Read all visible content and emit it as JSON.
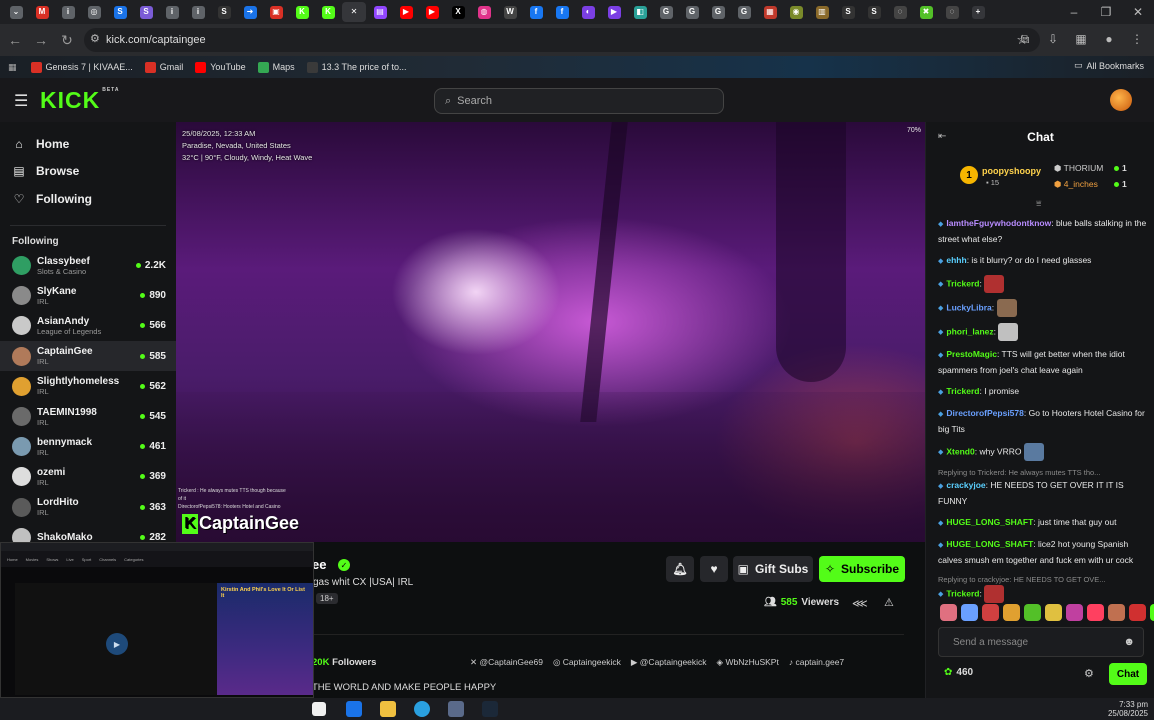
{
  "browser": {
    "url": "kick.com/captaingee",
    "tabs": [
      {
        "icon": "chevron-icon",
        "glyph": "⌄",
        "color": "#5f6368"
      },
      {
        "icon": "gmail-icon",
        "glyph": "M",
        "color": "#d93025"
      },
      {
        "icon": "page-icon",
        "glyph": "i",
        "color": "#5f6368"
      },
      {
        "icon": "page-icon",
        "glyph": "◎",
        "color": "#5f6368"
      },
      {
        "icon": "s-icon",
        "glyph": "S",
        "color": "#1a73e8"
      },
      {
        "icon": "s-icon",
        "glyph": "S",
        "color": "#7b5cd6"
      },
      {
        "icon": "page-icon",
        "glyph": "i",
        "color": "#5f6368"
      },
      {
        "icon": "page-icon",
        "glyph": "i",
        "color": "#5f6368"
      },
      {
        "icon": "s-icon",
        "glyph": "S",
        "color": "#333"
      },
      {
        "icon": "arrow-icon",
        "glyph": "➜",
        "color": "#1a73e8"
      },
      {
        "icon": "page-icon",
        "glyph": "▣",
        "color": "#d93025"
      },
      {
        "icon": "kick-icon",
        "glyph": "K",
        "color": "#53fc18"
      },
      {
        "icon": "kick-icon",
        "glyph": "K",
        "color": "#53fc18"
      },
      {
        "icon": "close-icon",
        "glyph": "✕",
        "color": "#35363a"
      },
      {
        "icon": "twitch-icon",
        "glyph": "▤",
        "color": "#9146ff"
      },
      {
        "icon": "youtube-icon",
        "glyph": "▶",
        "color": "#ff0000"
      },
      {
        "icon": "youtube-icon",
        "glyph": "▶",
        "color": "#ff0000"
      },
      {
        "icon": "x-icon",
        "glyph": "X",
        "color": "#000"
      },
      {
        "icon": "page-icon",
        "glyph": "◍",
        "color": "#e0338a"
      },
      {
        "icon": "wiki-icon",
        "glyph": "W",
        "color": "#444"
      },
      {
        "icon": "facebook-icon",
        "glyph": "f",
        "color": "#1877f2"
      },
      {
        "icon": "facebook-icon",
        "glyph": "f",
        "color": "#1877f2"
      },
      {
        "icon": "page-icon",
        "glyph": "◐",
        "color": "#7b3fe4"
      },
      {
        "icon": "play-icon",
        "glyph": "▶",
        "color": "#7b3fe4"
      },
      {
        "icon": "page-icon",
        "glyph": "◧",
        "color": "#2aa198"
      },
      {
        "icon": "google-icon",
        "glyph": "G",
        "color": "#5f6368"
      },
      {
        "icon": "google-icon",
        "glyph": "G",
        "color": "#5f6368"
      },
      {
        "icon": "google-icon",
        "glyph": "G",
        "color": "#5f6368"
      },
      {
        "icon": "google-icon",
        "glyph": "G",
        "color": "#5f6368"
      },
      {
        "icon": "page-icon",
        "glyph": "▦",
        "color": "#c0392b"
      },
      {
        "icon": "page-icon",
        "glyph": "◉",
        "color": "#7a8a2a"
      },
      {
        "icon": "page-icon",
        "glyph": "▥",
        "color": "#8a6a2a"
      },
      {
        "icon": "s-icon",
        "glyph": "S",
        "color": "#333"
      },
      {
        "icon": "s-icon",
        "glyph": "S",
        "color": "#333"
      },
      {
        "icon": "page-icon",
        "glyph": "◌",
        "color": "#444"
      },
      {
        "icon": "game-icon",
        "glyph": "✖",
        "color": "#53c028"
      },
      {
        "icon": "page-icon",
        "glyph": "◌",
        "color": "#444"
      },
      {
        "icon": "new-tab-icon",
        "glyph": "+",
        "color": "#35363a"
      }
    ],
    "bookmarks": [
      {
        "label": "Genesis 7 | KIVAAE...",
        "color": "#d93025"
      },
      {
        "label": "Gmail",
        "color": "#d93025"
      },
      {
        "label": "YouTube",
        "color": "#ff0000"
      },
      {
        "label": "Maps",
        "color": "#34a853"
      },
      {
        "label": "13.3 The price of to...",
        "color": "#3a3a3a"
      }
    ],
    "all_bookmarks": "All Bookmarks"
  },
  "kick": {
    "logo": "KICK",
    "logo_tag": "BETA",
    "search_placeholder": "Search",
    "nav": [
      {
        "label": "Home",
        "icon": "home-icon",
        "glyph": "⌂"
      },
      {
        "label": "Browse",
        "icon": "browse-icon",
        "glyph": "▤"
      },
      {
        "label": "Following",
        "icon": "heart-icon",
        "glyph": "♡"
      }
    ],
    "following_header": "Following",
    "channels": [
      {
        "name": "Classybeef",
        "category": "Slots & Casino",
        "viewers": "2.2K",
        "color": "#2f9e63"
      },
      {
        "name": "SlyKane",
        "category": "IRL",
        "viewers": "890",
        "color": "#8a8a8a"
      },
      {
        "name": "AsianAndy",
        "category": "League of Legends",
        "viewers": "566",
        "color": "#c9c9c9"
      },
      {
        "name": "CaptainGee",
        "category": "IRL",
        "viewers": "585",
        "color": "#b07a5a"
      },
      {
        "name": "Slightlyhomeless",
        "category": "IRL",
        "viewers": "562",
        "color": "#e0a030"
      },
      {
        "name": "TAEMIN1998",
        "category": "IRL",
        "viewers": "545",
        "color": "#6a6a6a"
      },
      {
        "name": "bennymack",
        "category": "IRL",
        "viewers": "461",
        "color": "#7a9ab0"
      },
      {
        "name": "ozemi",
        "category": "IRL",
        "viewers": "369",
        "color": "#dddddd"
      },
      {
        "name": "LordHito",
        "category": "IRL",
        "viewers": "363",
        "color": "#5a5a5a"
      },
      {
        "name": "ShakoMako",
        "category": "",
        "viewers": "282",
        "color": "#c0c0c0"
      }
    ]
  },
  "video": {
    "overlay_date": "25/08/2025, 12:33 AM",
    "overlay_location": "Paradise, Nevada, United States",
    "overlay_weather": "32°C | 90°F, Cloudy, Windy, Heat Wave",
    "battery": "70%",
    "overlay_chat_1": "Trickerd : He always mutes TTS though because",
    "overlay_chat_2": "of it",
    "overlay_chat_3": "DirectorofPepsi578: Hooters Hotel and Casino",
    "brand": "CaptainGee"
  },
  "channel_info": {
    "name_fragment": "ee",
    "stream_title": "gas whit CX |USA| IRL",
    "age": "18+",
    "gift_subs": "Gift Subs",
    "subscribe": "Subscribe",
    "viewers": "585",
    "viewers_label": "Viewers",
    "followers": "20K",
    "followers_label": "Followers",
    "socials": [
      "@CaptainGee69",
      "Captaingeekick",
      "@Captaingeekick",
      "WbNzHuSKPt",
      "captain.gee7"
    ],
    "bio": "THE WORLD AND MAKE PEOPLE HAPPY"
  },
  "chat": {
    "title": "Chat",
    "leaderboard": {
      "rank": "1",
      "user": "poopyshoopy",
      "sub": "15",
      "row1_name": "THORIUM",
      "row1_count": "1",
      "row2_name": "4_inches",
      "row2_count": "1"
    },
    "messages": [
      {
        "user": "IamtheFguywhodontknow",
        "color": "#b88cff",
        "text": ": blue balls stalking in the street what else?"
      },
      {
        "user": "ehhh",
        "color": "#5ad0ff",
        "text": ": is it blurry? or do I need glasses"
      },
      {
        "user": "Trickerd",
        "color": "#53fc18",
        "text": ":"
      },
      {
        "user": "LuckyLibra",
        "color": "#6aa0ff",
        "text": ":"
      },
      {
        "user": "phori_lanez",
        "color": "#53fc18",
        "text": ":"
      },
      {
        "user": "PrestoMagic",
        "color": "#53fc18",
        "text": ": TTS will get better when the idiot spammers from joel's chat leave again"
      },
      {
        "user": "Trickerd",
        "color": "#53fc18",
        "text": ": I promise"
      },
      {
        "user": "DirectorofPepsi578",
        "color": "#6aa0ff",
        "text": ": Go to Hooters Hotel Casino for big Tits"
      },
      {
        "user": "Xtend0",
        "color": "#53fc18",
        "text": ": why VRRO"
      },
      {
        "reply": "Replying to Trickerd: He always mutes TTS tho...",
        "user": "crackyjoe",
        "color": "#5ad0ff",
        "text": ": HE NEEDS TO GET OVER IT IT IS FUNNY"
      },
      {
        "user": "HUGE_LONG_SHAFT",
        "color": "#53fc18",
        "text": ": just time that guy out"
      },
      {
        "user": "HUGE_LONG_SHAFT",
        "color": "#53fc18",
        "text": ": lice2 hot young Spanish calves smush em together and fuck em with ur cock"
      },
      {
        "reply": "Replying to crackyjoe: HE NEEDS TO GET OVE...",
        "user": "Trickerd",
        "color": "#53fc18",
        "text": ":"
      }
    ],
    "input_placeholder": "Send a message",
    "points": "460",
    "send_label": "Chat"
  },
  "pip": {
    "title": "Kirstin And Phil's Love It Or List It",
    "nav": [
      "Home",
      "Movies",
      "Shows",
      "Live",
      "Sport",
      "Channels",
      "Categories"
    ]
  },
  "taskbar": {
    "time": "7:33 pm",
    "date": "25/08/2025"
  }
}
